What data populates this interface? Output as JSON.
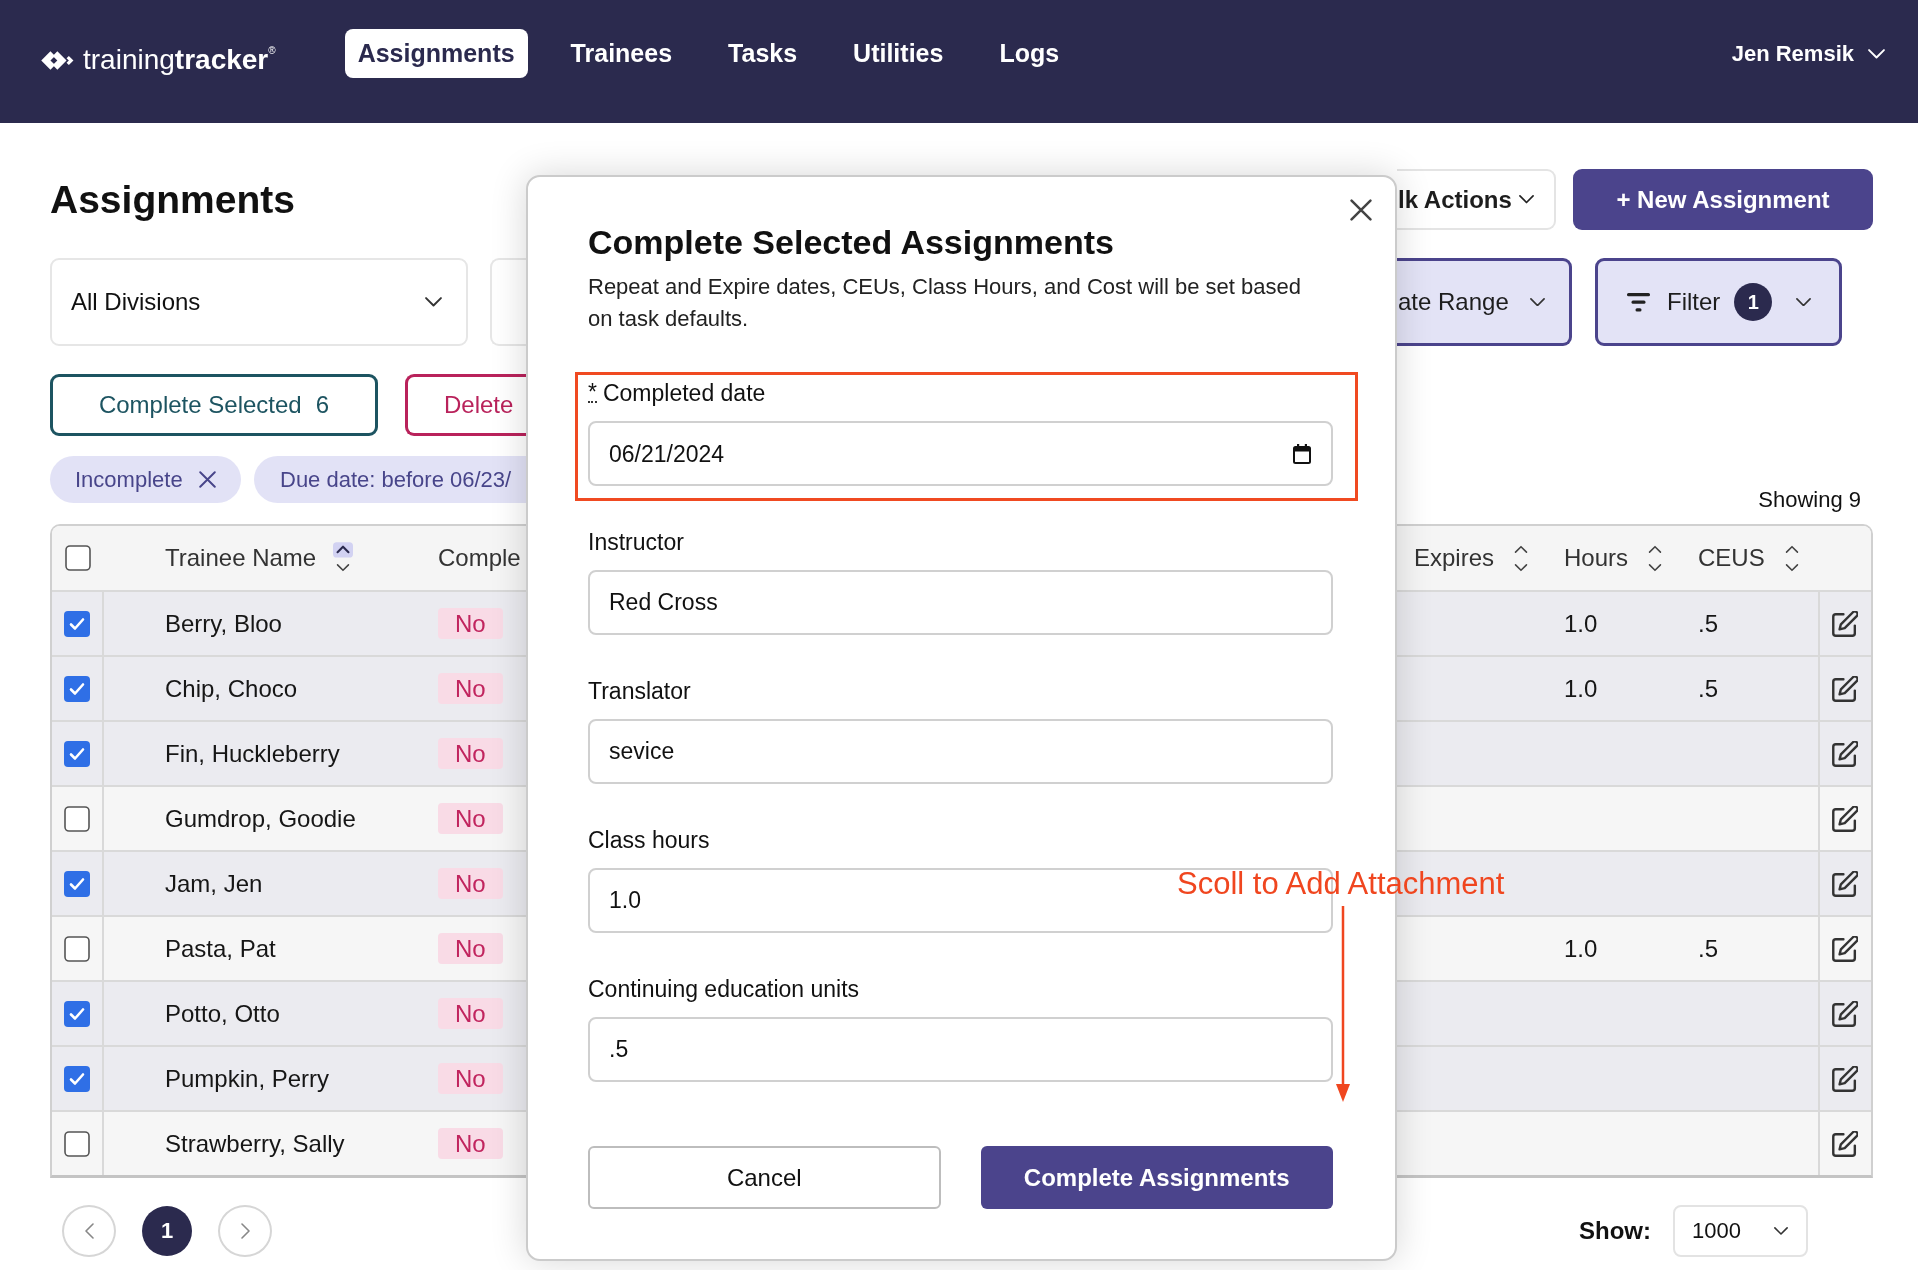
{
  "header": {
    "logo": "training**tracker**$^{®}$",
    "nav": [
      {
        "label": "Assignments",
        "selected": true
      },
      {
        "label": "Trainees",
        "selected": false
      },
      {
        "label": "Tasks",
        "selected": false
      },
      {
        "label": "Utilities",
        "selected": false
      },
      {
        "label": "Logs",
        "selected": false
      }
    ],
    "user": "Jen Remsik"
  },
  "page": {
    "title": "Assignments",
    "bulk_actions": "lk Actions",
    "new_button": "+ New Assignment"
  },
  "filters": {
    "division": "All Divisions",
    "date_range": "ate Range",
    "filter": {
      "label": "Filter",
      "count": "1"
    }
  },
  "actions": {
    "complete": {
      "label": "Complete Selected",
      "count": "6"
    },
    "delete": "Delete"
  },
  "chips": [
    {
      "label": "Incomplete",
      "removable": true
    },
    {
      "label": "Due date: before 06/23/"
    }
  ],
  "showing": "Showing 9",
  "table": {
    "all_selected": false,
    "columns": [
      {
        "label": "Trainee Name",
        "sorted": true
      },
      {
        "label": "Comple"
      },
      {
        "label": "Expires",
        "sorted": false
      },
      {
        "label": "Hours",
        "sorted": false
      },
      {
        "label": "CEUS",
        "sorted": false
      }
    ],
    "rows": [
      {
        "name": "Berry, Bloo",
        "selected": true,
        "completed": "No",
        "hours": "1.0",
        "ceus": ".5"
      },
      {
        "name": "Chip, Choco",
        "selected": true,
        "completed": "No",
        "hours": "1.0",
        "ceus": ".5"
      },
      {
        "name": "Fin, Huckleberry",
        "selected": true,
        "completed": "No"
      },
      {
        "name": "Gumdrop, Goodie",
        "selected": false,
        "completed": "No"
      },
      {
        "name": "Jam, Jen",
        "selected": true,
        "completed": "No"
      },
      {
        "name": "Pasta, Pat",
        "selected": false,
        "completed": "No",
        "hours": "1.0",
        "ceus": ".5"
      },
      {
        "name": "Potto, Otto",
        "selected": true,
        "completed": "No"
      },
      {
        "name": "Pumpkin, Perry",
        "selected": true,
        "completed": "No"
      },
      {
        "name": "Strawberry, Sally",
        "selected": false,
        "completed": "No"
      }
    ]
  },
  "pagination": {
    "pages": [
      {
        "label": "1",
        "selected": true
      }
    ]
  },
  "page_size": {
    "label": "Show:",
    "value": "1000"
  },
  "dialog": {
    "title": "Complete Selected Assignments",
    "description": "Repeat and Expire dates, CEUs, Class Hours, and Cost will be set based on task defaults.",
    "fields": [
      {
        "kind": "date",
        "required_mark": "*",
        "label": "Completed date",
        "value": "06/21/2024",
        "highlighted": true
      },
      {
        "kind": "text",
        "label": "Instructor",
        "value": "Red Cross",
        "highlighted": false
      },
      {
        "kind": "text",
        "label": "Translator",
        "value": "sevice",
        "highlighted": false
      },
      {
        "kind": "text",
        "label": "Class hours",
        "value": "1.0",
        "highlighted": false
      },
      {
        "kind": "text",
        "label": "Continuing education units",
        "value": ".5",
        "highlighted": false
      }
    ],
    "buttons": [
      {
        "kind": "secondary",
        "label": "Cancel"
      },
      {
        "kind": "primary",
        "label": "Complete Assignments"
      }
    ]
  },
  "annotation": {
    "note": "Scoll to Add Attachment"
  }
}
